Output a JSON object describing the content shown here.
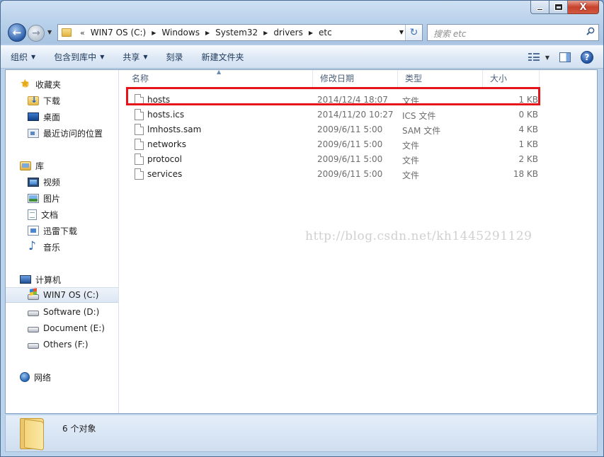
{
  "window": {
    "caption": {
      "minimize": "",
      "maximize": "",
      "close": "X"
    }
  },
  "nav": {
    "overflow_glyph": "«",
    "breadcrumbs": [
      "WIN7 OS (C:)",
      "Windows",
      "System32",
      "drivers",
      "etc"
    ],
    "search_placeholder": "搜索 etc"
  },
  "toolbar": {
    "items": [
      "组织",
      "包含到库中",
      "共享",
      "刻录",
      "新建文件夹"
    ]
  },
  "sidebar": {
    "favorites": {
      "label": "收藏夹",
      "items": [
        "下载",
        "桌面",
        "最近访问的位置"
      ]
    },
    "libraries": {
      "label": "库",
      "items": [
        "视频",
        "图片",
        "文档",
        "迅雷下载",
        "音乐"
      ]
    },
    "computer": {
      "label": "计算机",
      "items": [
        "WIN7 OS (C:)",
        "Software (D:)",
        "Document (E:)",
        "Others (F:)"
      ],
      "selected": "WIN7 OS (C:)"
    },
    "network": {
      "label": "网络"
    }
  },
  "columns": {
    "name": "名称",
    "date": "修改日期",
    "type": "类型",
    "size": "大小"
  },
  "files": [
    {
      "name": "hosts",
      "date": "2014/12/4 18:07",
      "type": "文件",
      "size": "1 KB"
    },
    {
      "name": "hosts.ics",
      "date": "2014/11/20 10:27",
      "type": "ICS 文件",
      "size": "0 KB"
    },
    {
      "name": "lmhosts.sam",
      "date": "2009/6/11 5:00",
      "type": "SAM 文件",
      "size": "4 KB"
    },
    {
      "name": "networks",
      "date": "2009/6/11 5:00",
      "type": "文件",
      "size": "1 KB"
    },
    {
      "name": "protocol",
      "date": "2009/6/11 5:00",
      "type": "文件",
      "size": "2 KB"
    },
    {
      "name": "services",
      "date": "2009/6/11 5:00",
      "type": "文件",
      "size": "18 KB"
    }
  ],
  "highlighted_file": "hosts",
  "highlight_color": "#e5141b",
  "watermark": "http://blog.csdn.net/kh1445291129",
  "status": {
    "text": "6 个对象"
  }
}
